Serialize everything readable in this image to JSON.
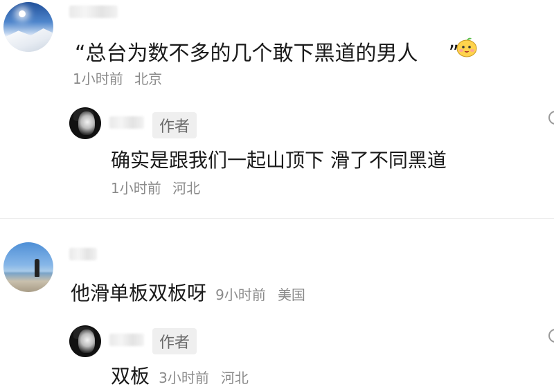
{
  "comments": [
    {
      "text": "“总台为数不多的几个敢下黑道的男人",
      "close_quote": "”",
      "emoji": "mango-face-emoji",
      "time": "1小时前",
      "location": "北京",
      "reply": {
        "author_tag": "作者",
        "text": "确实是跟我们一起山顶下 滑了不同黑道",
        "time": "1小时前",
        "location": "河北"
      }
    },
    {
      "text": "他滑单板双板呀",
      "time": "9小时前",
      "location": "美国",
      "reply": {
        "author_tag": "作者",
        "text": "双板",
        "time": "3小时前",
        "location": "河北"
      }
    }
  ],
  "colors": {
    "text": "#1a1a1a",
    "meta": "#8a8a8a",
    "tag_bg": "#efefef"
  }
}
